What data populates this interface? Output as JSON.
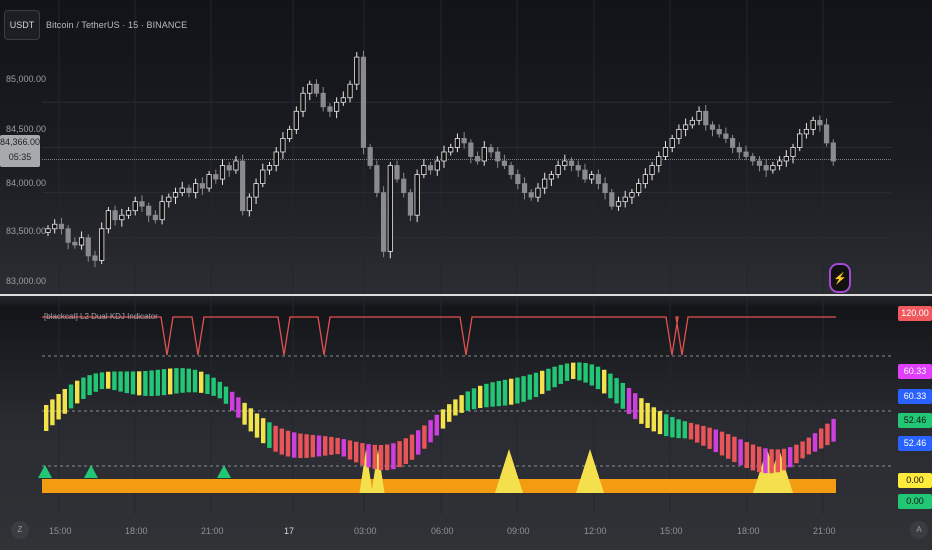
{
  "header": {
    "symbol_badge": "USDT",
    "title": "Bitcoin / TetherUS · 15 · BINANCE"
  },
  "price_axis": {
    "labels": [
      "85,000.00",
      "84,500.00",
      "84,000.00",
      "83,500.00",
      "83,000.00"
    ],
    "current_price": "84,366.00",
    "countdown": "05:35"
  },
  "indicator": {
    "title": "[blackcat] L2 Dual KDJ Indicator",
    "values": {
      "top": "120.00",
      "v1": "60.33",
      "v2": "60.33",
      "v3": "52.46",
      "v4": "52.46",
      "v5": "0.00",
      "v6": "0.00"
    },
    "colors": {
      "top": "#f05a5f",
      "v1": "#e040fb",
      "v2": "#2962ff",
      "v3": "#22c776",
      "v4": "#2962ff",
      "v5": "#ffeb3b",
      "v6": "#22c776"
    }
  },
  "time_axis": {
    "labels": [
      "15:00",
      "18:00",
      "21:00",
      "17",
      "03:00",
      "06:00",
      "09:00",
      "12:00",
      "15:00",
      "18:00",
      "21:00"
    ]
  },
  "bottom": {
    "left_icon": "Z",
    "right_icon": "A",
    "alert_icon": "lightning-icon"
  },
  "chart_data": {
    "type": "candlestick",
    "title": "Bitcoin / TetherUS · 15 · BINANCE",
    "ylim": [
      82900,
      85800
    ],
    "y_ticks": [
      85000,
      84500,
      84000,
      83500,
      83000
    ],
    "current_price": 84366,
    "close_series": [
      83600,
      83650,
      83600,
      83450,
      83420,
      83500,
      83300,
      83250,
      83600,
      83800,
      83700,
      83750,
      83800,
      83900,
      83850,
      83750,
      83700,
      83900,
      83950,
      84000,
      84050,
      84000,
      84100,
      84050,
      84200,
      84150,
      84300,
      84250,
      84350,
      83800,
      83950,
      84100,
      84250,
      84300,
      84450,
      84600,
      84700,
      84900,
      85100,
      85200,
      85100,
      84950,
      84900,
      85000,
      85050,
      85200,
      85500,
      84500,
      84300,
      84000,
      83350,
      84300,
      84150,
      84000,
      83750,
      84200,
      84300,
      84250,
      84350,
      84450,
      84500,
      84600,
      84550,
      84400,
      84350,
      84500,
      84450,
      84350,
      84300,
      84200,
      84100,
      84000,
      83950,
      84050,
      84150,
      84200,
      84300,
      84350,
      84300,
      84250,
      84150,
      84200,
      84100,
      84000,
      83850,
      83900,
      83950,
      84000,
      84100,
      84200,
      84300,
      84400,
      84500,
      84600,
      84700,
      84750,
      84800,
      84900,
      84750,
      84700,
      84650,
      84600,
      84500,
      84450,
      84400,
      84350,
      84300,
      84250,
      84300,
      84350,
      84400,
      84500,
      84650,
      84700,
      84800,
      84750,
      84550,
      84350
    ]
  }
}
